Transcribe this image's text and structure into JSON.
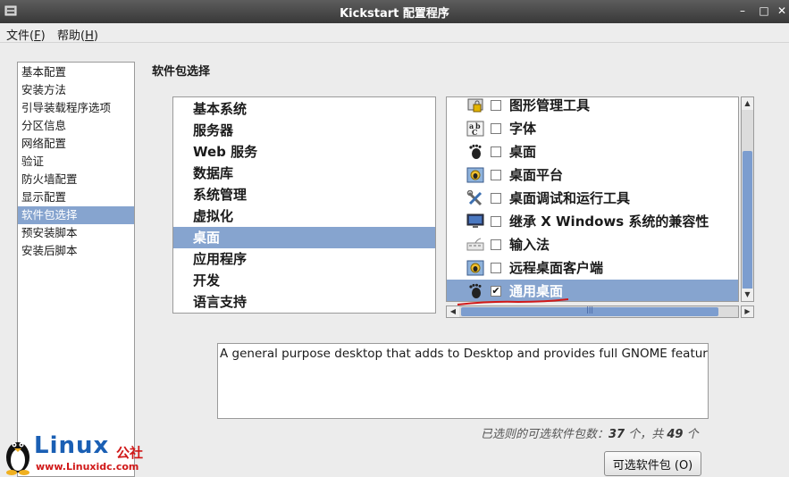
{
  "window": {
    "title": "Kickstart 配置程序",
    "controls": {
      "minimize": "–",
      "maximize": "□",
      "close": "✕"
    }
  },
  "menubar": [
    {
      "label": "文件(",
      "mnemonic": "F",
      "suffix": ")"
    },
    {
      "label": "帮助(",
      "mnemonic": "H",
      "suffix": ")"
    }
  ],
  "sidebar": {
    "items": [
      {
        "label": "基本配置",
        "selected": false
      },
      {
        "label": "安装方法",
        "selected": false
      },
      {
        "label": "引导装载程序选项",
        "selected": false
      },
      {
        "label": "分区信息",
        "selected": false
      },
      {
        "label": "网络配置",
        "selected": false
      },
      {
        "label": "验证",
        "selected": false
      },
      {
        "label": "防火墙配置",
        "selected": false
      },
      {
        "label": "显示配置",
        "selected": false
      },
      {
        "label": "软件包选择",
        "selected": true
      },
      {
        "label": "预安装脚本",
        "selected": false
      },
      {
        "label": "安装后脚本",
        "selected": false
      }
    ]
  },
  "main": {
    "section_title": "软件包选择",
    "categories": [
      {
        "label": "基本系统",
        "selected": false
      },
      {
        "label": "服务器",
        "selected": false
      },
      {
        "label": "Web 服务",
        "selected": false
      },
      {
        "label": "数据库",
        "selected": false
      },
      {
        "label": "系统管理",
        "selected": false
      },
      {
        "label": "虚拟化",
        "selected": false
      },
      {
        "label": "桌面",
        "selected": true
      },
      {
        "label": "应用程序",
        "selected": false
      },
      {
        "label": "开发",
        "selected": false
      },
      {
        "label": "语言支持",
        "selected": false
      }
    ],
    "packages": [
      {
        "label": "图形管理工具",
        "icon": "lock-admin-icon",
        "checked": false,
        "selected": false
      },
      {
        "label": "字体",
        "icon": "font-icon",
        "checked": false,
        "selected": false
      },
      {
        "label": "桌面",
        "icon": "gnome-foot-icon",
        "checked": false,
        "selected": false
      },
      {
        "label": "桌面平台",
        "icon": "desktop-platform-icon",
        "checked": false,
        "selected": false
      },
      {
        "label": "桌面调试和运行工具",
        "icon": "tools-icon",
        "checked": false,
        "selected": false
      },
      {
        "label": "继承 X Windows 系统的兼容性",
        "icon": "monitor-icon",
        "checked": false,
        "selected": false
      },
      {
        "label": "输入法",
        "icon": "keyboard-icon",
        "checked": false,
        "selected": false
      },
      {
        "label": "远程桌面客户端",
        "icon": "remote-desktop-icon",
        "checked": false,
        "selected": false
      },
      {
        "label": "通用桌面",
        "icon": "gnome-foot-icon",
        "checked": true,
        "selected": true
      }
    ],
    "check_mark": "✔",
    "description": "A general purpose desktop that adds to Desktop and provides full GNOME features.",
    "count_text": {
      "prefix": "已选则的可选软件包数：",
      "selected": "37",
      "middle": " 个，共 ",
      "total": "49",
      "suffix": " 个"
    },
    "optional_button": "可选软件包 (O)"
  },
  "watermark": {
    "brand": "Linux",
    "brand_cn": "公社",
    "url": "www.Linuxidc.com"
  },
  "colors": {
    "selection": "#86a4cf",
    "titlebar": "#383838",
    "annotation": "#d01818"
  }
}
